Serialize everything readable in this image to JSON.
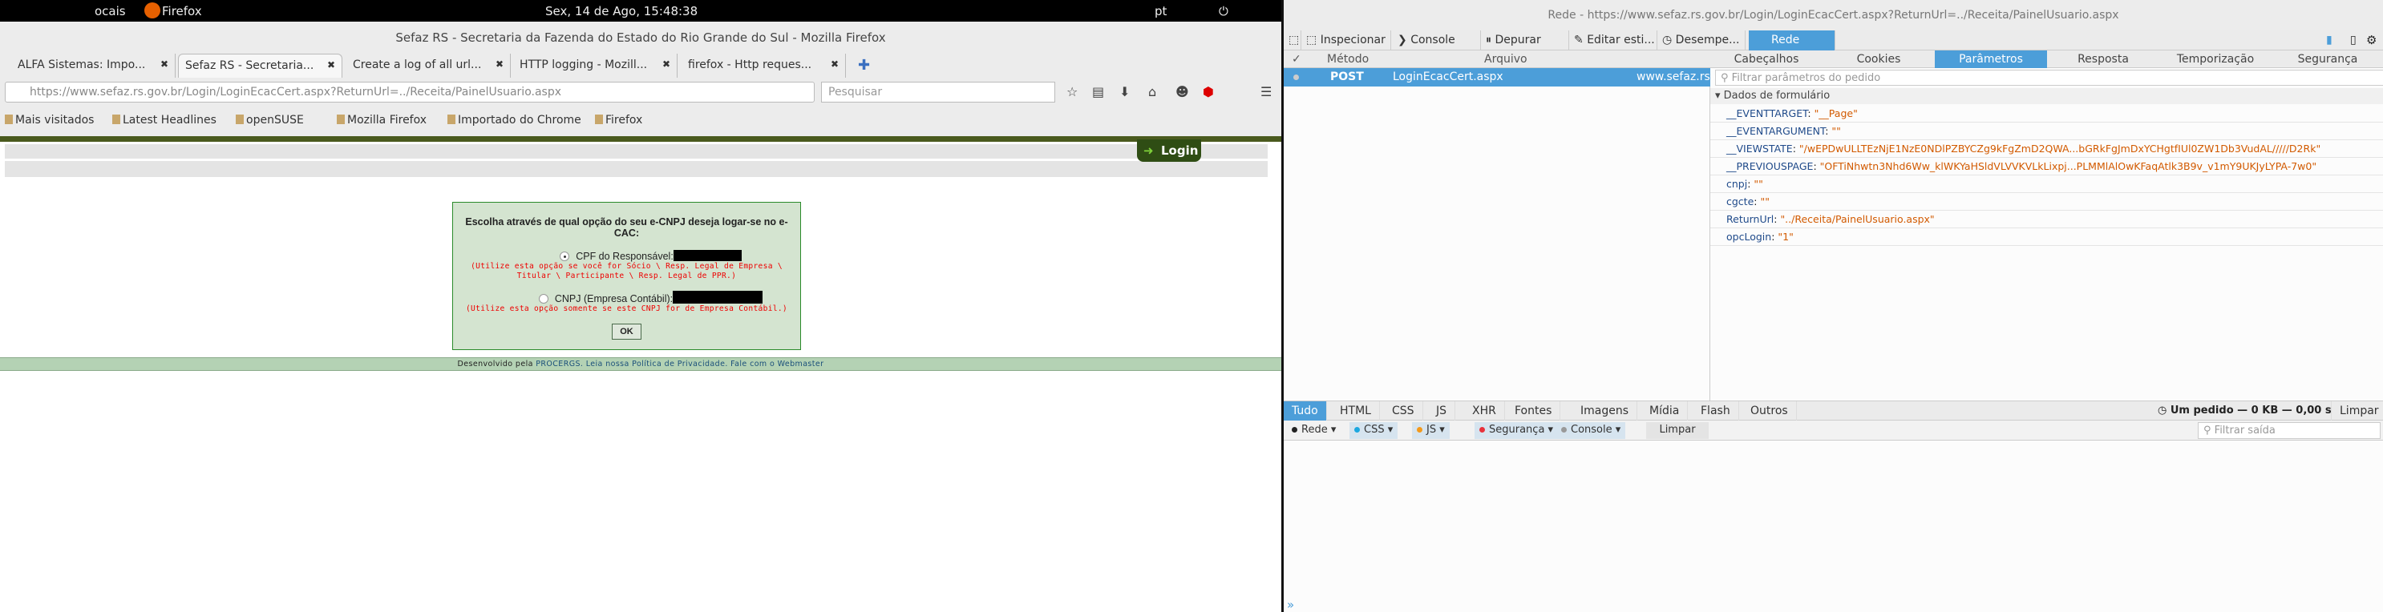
{
  "system": {
    "user": "ocais",
    "app": "Firefox",
    "clock": "Sex, 14 de Ago, 15:48:38",
    "lang": "pt"
  },
  "browser": {
    "title": "Sefaz RS - Secretaria da Fazenda do Estado do Rio Grande do Sul - Mozilla Firefox",
    "tabs": [
      {
        "label": "ALFA Sistemas: Impo..."
      },
      {
        "label": "Sefaz RS - Secretaria..."
      },
      {
        "label": "Create a log of all url..."
      },
      {
        "label": "HTTP logging - Mozill..."
      },
      {
        "label": "firefox - Http reques..."
      }
    ],
    "url": "https://www.sefaz.rs.gov.br/Login/LoginEcacCert.aspx?ReturnUrl=../Receita/PainelUsuario.aspx",
    "search_placeholder": "Pesquisar",
    "bookmarks": [
      "Mais visitados",
      "Latest Headlines",
      "openSUSE",
      "Mozilla Firefox",
      "Importado do Chrome",
      "Firefox"
    ]
  },
  "page": {
    "login_label": "Login",
    "question": "Escolha através de qual opção do seu e-CNPJ deseja logar-se no e-CAC:",
    "options": [
      {
        "label": "CPF do Responsável:",
        "hint": "(Utilize esta opção se você for Sócio \\ Resp. Legal de Empresa \\ Titular \\ Participante \\ Resp. Legal de PPR.)",
        "selected": true
      },
      {
        "label": "CNPJ (Empresa Contábil):",
        "hint": "(Utilize esta opção somente se este CNPJ for de Empresa Contábil.)",
        "selected": false
      }
    ],
    "ok_label": "OK",
    "footer": {
      "prefix": "Desenvolvido pela",
      "procergs": "PROCERGS.",
      "privacy": "Leia nossa Política de Privacidade.",
      "webmaster": "Fale com o Webmaster"
    }
  },
  "devtools": {
    "title": "Rede - https://www.sefaz.rs.gov.br/Login/LoginEcacCert.aspx?ReturnUrl=../Receita/PainelUsuario.aspx",
    "tools": [
      "Inspecionar",
      "Console",
      "Depurar",
      "Editar esti...",
      "Desempe...",
      "Rede"
    ],
    "columns": [
      "✓",
      "Método",
      "Arquivo"
    ],
    "request": {
      "method": "POST",
      "file": "LoginEcacCert.aspx",
      "domain": "www.sefaz.rs.g"
    },
    "panel_tabs": [
      "Cabeçalhos",
      "Cookies",
      "Parâmetros",
      "Resposta",
      "Temporização",
      "Segurança"
    ],
    "filter_placeholder": "Filtrar parâmetros do pedido",
    "section": "Dados de formulário",
    "params": [
      {
        "k": "__EVENTTARGET",
        "v": "\"__Page\""
      },
      {
        "k": "__EVENTARGUMENT",
        "v": "\"\""
      },
      {
        "k": "__VIEWSTATE",
        "v": "\"/wEPDwULLTEzNjE1NzE0NDlPZBYCZg9kFgZmD2QWA...bGRkFgJmDxYCHgtfIUl0ZW1Db3VudAL/////D2Rk\""
      },
      {
        "k": "__PREVIOUSPAGE",
        "v": "\"OFTiNhwtn3Nhd6Ww_klWKYaHSldVLVVKVLkLixpj...PLMMlAlOwKFaqAtlk3B9v_v1mY9UKJyLYPA-7w0\""
      },
      {
        "k": "cnpj",
        "v": "\"\""
      },
      {
        "k": "cgcte",
        "v": "\"\""
      },
      {
        "k": "ReturnUrl",
        "v": "\"../Receita/PainelUsuario.aspx\""
      },
      {
        "k": "opcLogin",
        "v": "\"1\""
      }
    ],
    "type_tabs": [
      "Tudo",
      "HTML",
      "CSS",
      "JS",
      "XHR",
      "Fontes",
      "Imagens",
      "Mídia",
      "Flash",
      "Outros"
    ],
    "summary": "Um pedido — 0 KB — 0,00 s",
    "clear": "Limpar",
    "console_filters": [
      {
        "label": "Rede",
        "color": "#222222"
      },
      {
        "label": "CSS",
        "color": "#1ca8e0"
      },
      {
        "label": "JS",
        "color": "#f39a1c"
      },
      {
        "label": "Segurança",
        "color": "#e8313a"
      },
      {
        "label": "Console",
        "color": "#999999"
      }
    ],
    "console_clear": "Limpar",
    "output_filter_placeholder": "Filtrar saída",
    "prompt": "»"
  }
}
